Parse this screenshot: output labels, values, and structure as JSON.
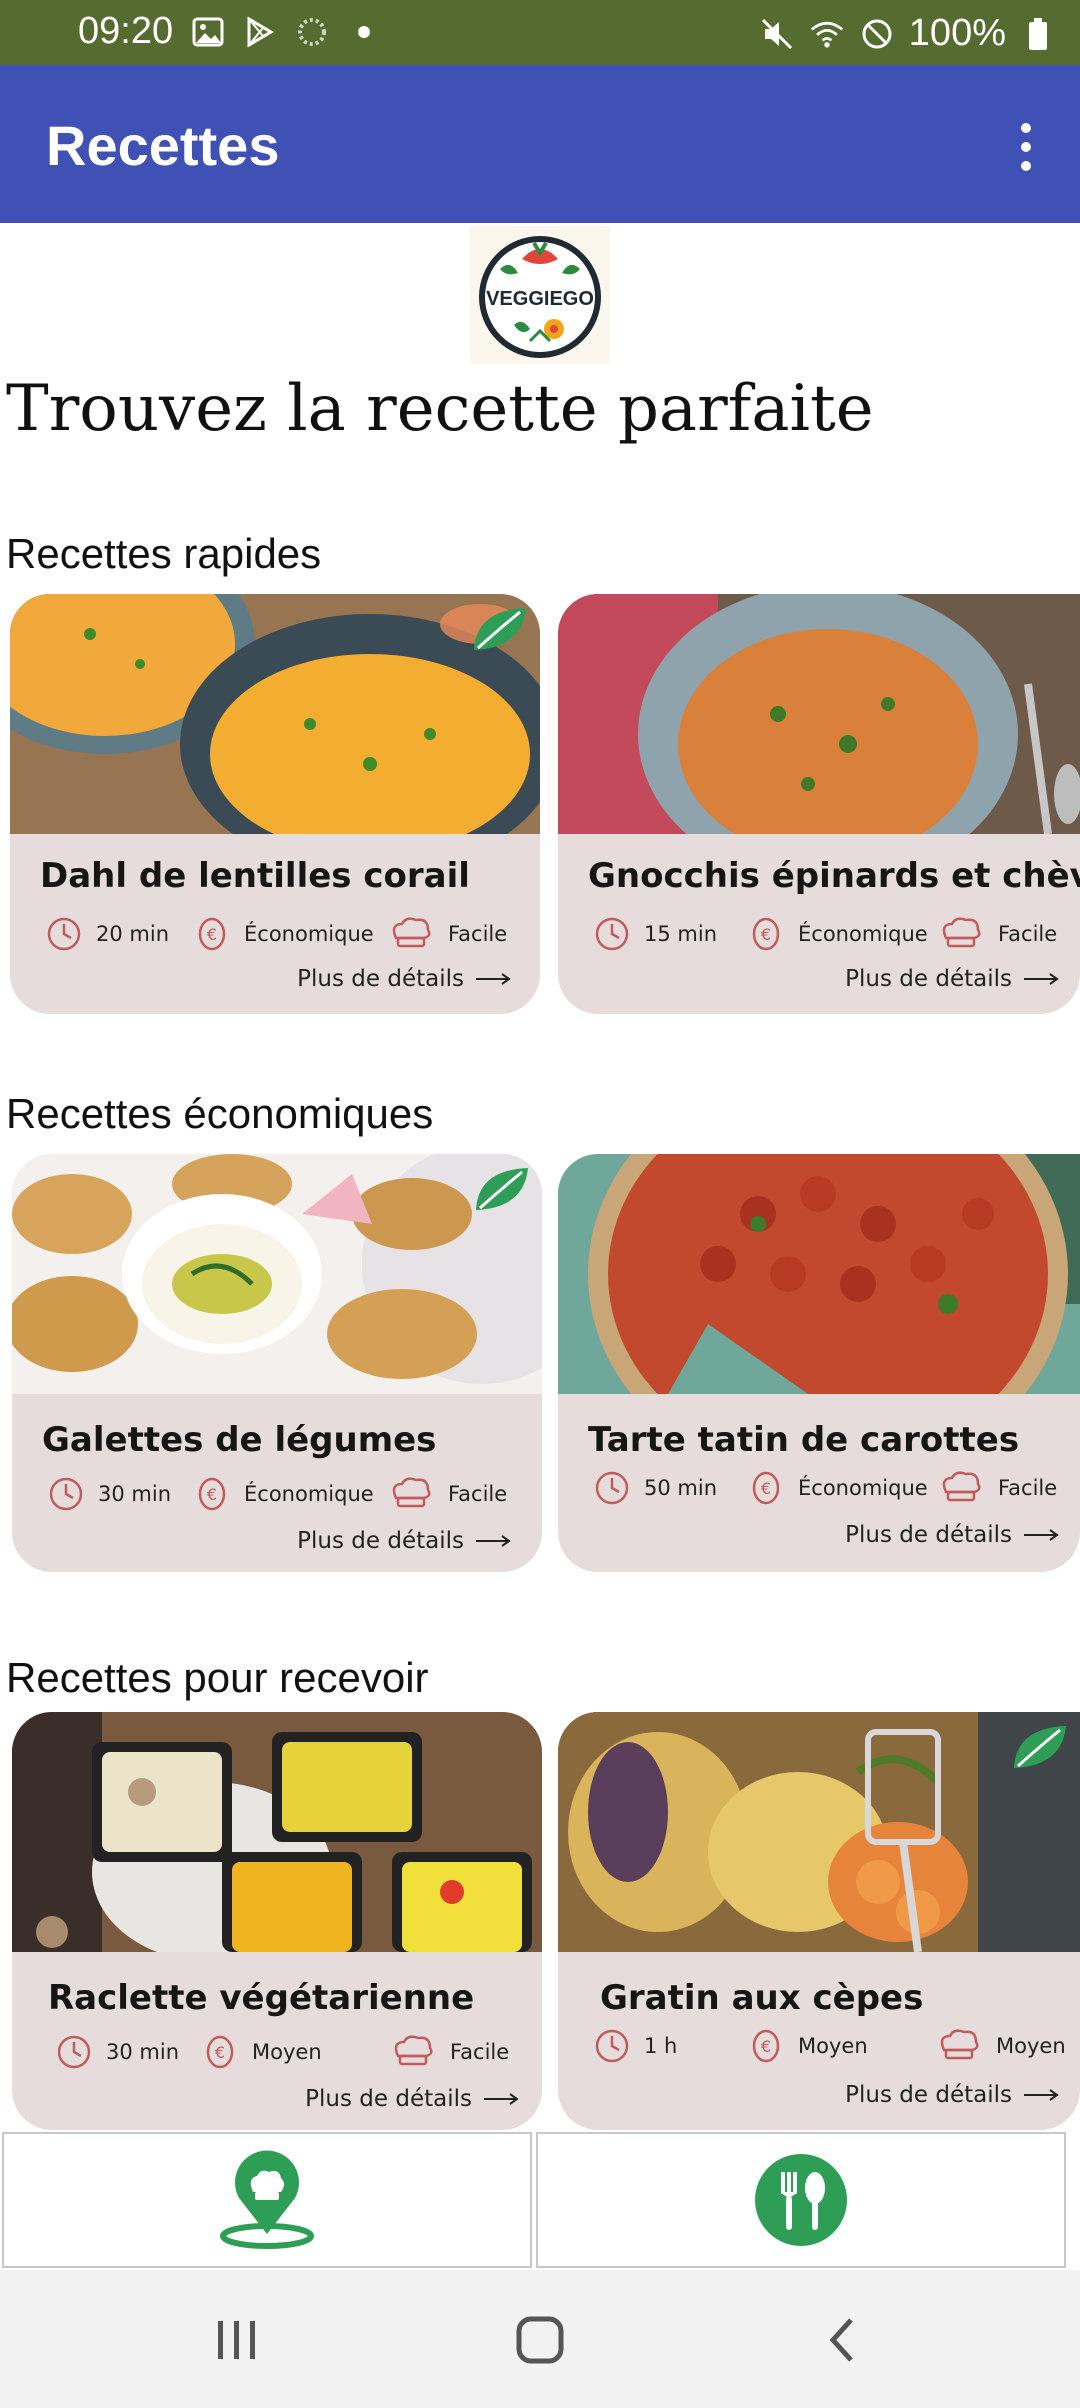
{
  "status_bar": {
    "time": "09:20",
    "battery": "100%",
    "left_icons": [
      "gallery-icon",
      "play-store-icon",
      "loading-icon",
      "dot-icon"
    ],
    "right_icons": [
      "mute-icon",
      "wifi-icon",
      "do-not-disturb-icon",
      "battery-icon"
    ]
  },
  "app_bar": {
    "title": "Recettes",
    "menu_icon": "more-vert-icon",
    "color": "#3f51b5"
  },
  "logo": {
    "text": "VEGGIEGO"
  },
  "heading": "Trouvez la recette parfaite",
  "sections": [
    {
      "title": "Recettes rapides",
      "recipes": [
        {
          "name": "Dahl de lentilles corail",
          "time": "20 min",
          "cost": "Économique",
          "difficulty": "Facile",
          "details": "Plus de détails",
          "veggie_badge": true
        },
        {
          "name": "Gnocchis épinards et chèvre",
          "time": "15 min",
          "cost": "Économique",
          "difficulty": "Facile",
          "details": "Plus de détails",
          "veggie_badge": false
        }
      ]
    },
    {
      "title": "Recettes économiques",
      "recipes": [
        {
          "name": "Galettes de légumes",
          "time": "30 min",
          "cost": "Économique",
          "difficulty": "Facile",
          "details": "Plus de détails",
          "veggie_badge": true
        },
        {
          "name": "Tarte tatin de carottes",
          "time": "50 min",
          "cost": "Économique",
          "difficulty": "Facile",
          "details": "Plus de détails",
          "veggie_badge": false
        }
      ]
    },
    {
      "title": "Recettes pour recevoir",
      "recipes": [
        {
          "name": "Raclette végétarienne",
          "time": "30 min",
          "cost": "Moyen",
          "difficulty": "Facile",
          "details": "Plus de détails",
          "veggie_badge": false
        },
        {
          "name": "Gratin aux cèpes",
          "time": "1 h",
          "cost": "Moyen",
          "difficulty": "Moyen",
          "details": "Plus de détails",
          "veggie_badge": true
        }
      ]
    }
  ],
  "tabs": [
    {
      "icon": "chef-location-icon"
    },
    {
      "icon": "cutlery-icon"
    }
  ],
  "colors": {
    "status_bar": "#556b2f",
    "card_bg": "#e7dcdc",
    "accent_green": "#2e9e57",
    "meta_icon": "#c05b5b"
  }
}
